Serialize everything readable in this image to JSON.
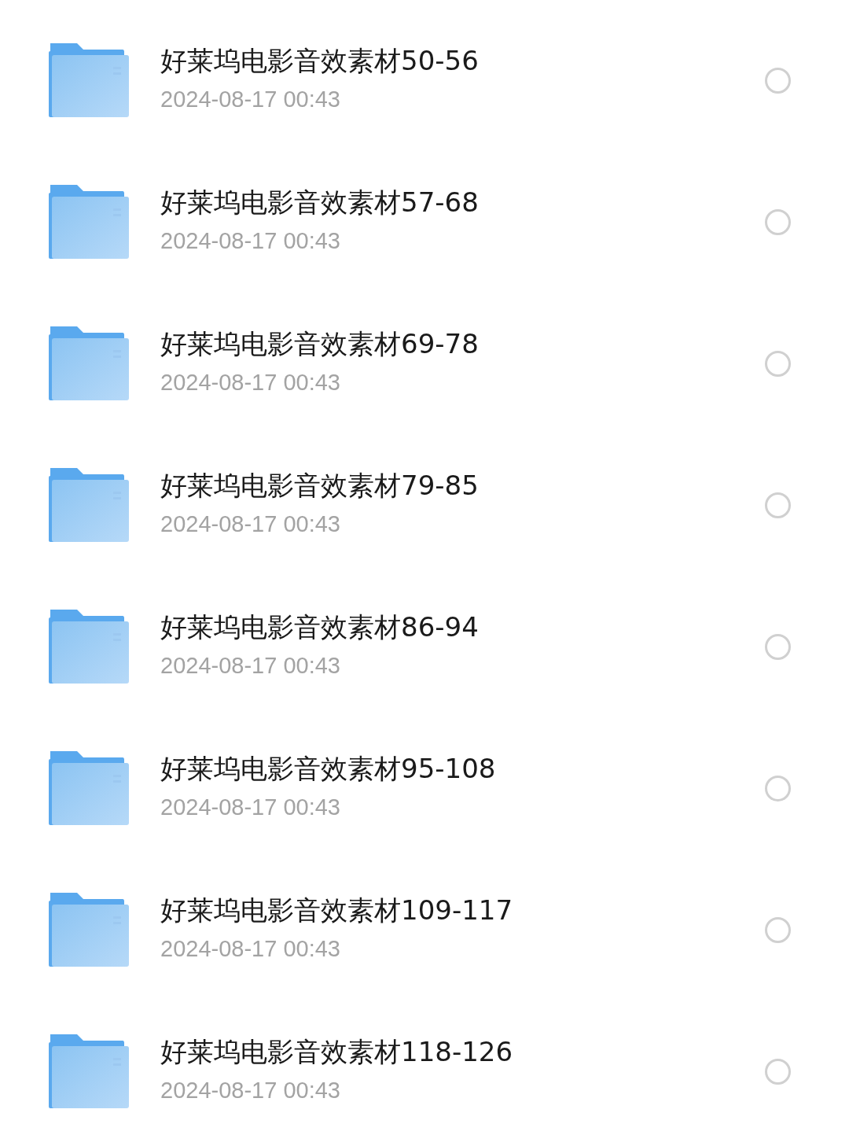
{
  "files": [
    {
      "name": "好莱坞电影音效素材50-56",
      "date": "2024-08-17 00:43",
      "selected": false
    },
    {
      "name": "好莱坞电影音效素材57-68",
      "date": "2024-08-17 00:43",
      "selected": false
    },
    {
      "name": "好莱坞电影音效素材69-78",
      "date": "2024-08-17 00:43",
      "selected": false
    },
    {
      "name": "好莱坞电影音效素材79-85",
      "date": "2024-08-17 00:43",
      "selected": false
    },
    {
      "name": "好莱坞电影音效素材86-94",
      "date": "2024-08-17 00:43",
      "selected": false
    },
    {
      "name": "好莱坞电影音效素材95-108",
      "date": "2024-08-17 00:43",
      "selected": false
    },
    {
      "name": "好莱坞电影音效素材109-117",
      "date": "2024-08-17 00:43",
      "selected": false
    },
    {
      "name": "好莱坞电影音效素材118-126",
      "date": "2024-08-17 00:43",
      "selected": false
    }
  ]
}
